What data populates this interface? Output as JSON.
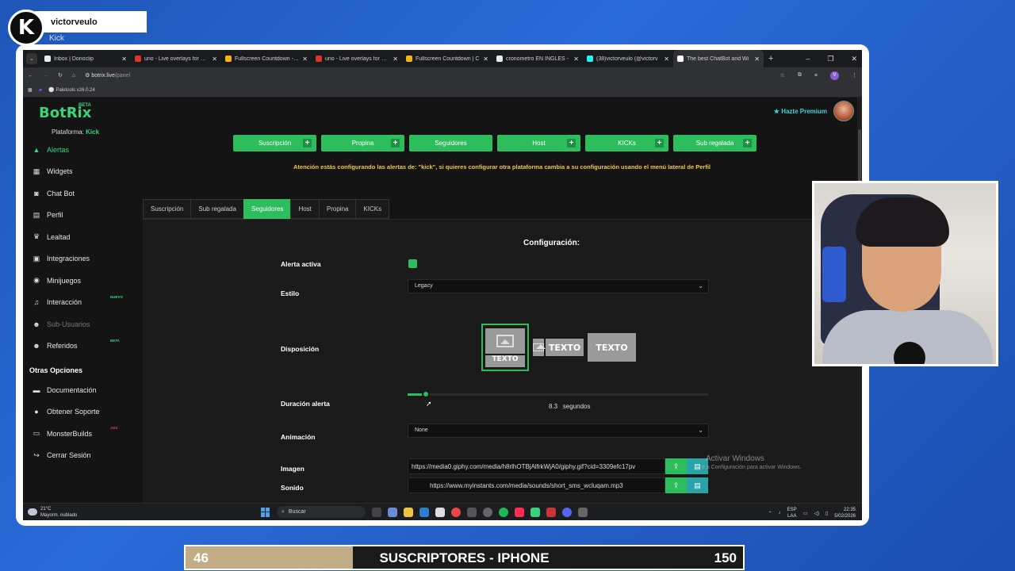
{
  "stream": {
    "channel_name": "victorveulo",
    "platform_label": "Kick"
  },
  "browser": {
    "tabs": [
      {
        "title": "Inbox | Donoclip",
        "color": "#e8eaed"
      },
      {
        "title": "uno - Live overlays for stre",
        "color": "#d8372a"
      },
      {
        "title": "Fullscreen Countdown - O",
        "color": "#f7b21a"
      },
      {
        "title": "uno - Live overlays for stre",
        "color": "#d8372a"
      },
      {
        "title": "Fullscreen Countdown | C",
        "color": "#f7b21a"
      },
      {
        "title": "cronometro EN INGLES -",
        "color": "#e8eaed"
      },
      {
        "title": "(38)victorveulo (@victorv",
        "color": "#25f4ee"
      },
      {
        "title": "The best ChatBot and Wi",
        "color": "#ffffff"
      }
    ],
    "url_host": "botrix.live",
    "url_path": "/panel",
    "bookmark": "Paletools v26.0.24"
  },
  "app": {
    "logo": "BotRix",
    "logo_badge": "BETA",
    "platform_label": "Plataforma:",
    "platform_value": "Kick",
    "premium": "Hazte Premium",
    "nav": [
      {
        "label": "Alertas",
        "icon": "bell-icon",
        "glyph": "▲"
      },
      {
        "label": "Widgets",
        "icon": "grid-icon",
        "glyph": "▦"
      },
      {
        "label": "Chat Bot",
        "icon": "robot-icon",
        "glyph": "◙"
      },
      {
        "label": "Perfil",
        "icon": "id-card-icon",
        "glyph": "▤"
      },
      {
        "label": "Lealtad",
        "icon": "trophy-icon",
        "glyph": "♛"
      },
      {
        "label": "Integraciones",
        "icon": "plug-icon",
        "glyph": "▣"
      },
      {
        "label": "Minijuegos",
        "icon": "gamepad-icon",
        "glyph": "◉"
      },
      {
        "label": "Interacción",
        "icon": "music-icon",
        "glyph": "♫",
        "tag": "NUEVO"
      },
      {
        "label": "Sub-Usuarios",
        "icon": "users-icon",
        "glyph": "☻"
      },
      {
        "label": "Referidos",
        "icon": "referrals-icon",
        "glyph": "☻",
        "tag": "BETA"
      }
    ],
    "other_title": "Otras Opciones",
    "other": [
      {
        "label": "Documentación",
        "icon": "book-icon",
        "glyph": "▬"
      },
      {
        "label": "Obtener Soporte",
        "icon": "support-icon",
        "glyph": "●"
      },
      {
        "label": "MonsterBuilds",
        "icon": "monitor-icon",
        "glyph": "▭",
        "tag": "ADS"
      },
      {
        "label": "Cerrar Sesión",
        "icon": "logout-icon",
        "glyph": "↪"
      }
    ],
    "alert_types": [
      "Suscripción",
      "Propina",
      "Seguidores",
      "Host",
      "KICKs",
      "Sub regalada"
    ],
    "warning": "Atención estás configurando las alertas de: \"kick\", si quieres configurar otra plataforma cambia a su configuración usando el menú lateral de Perfil",
    "subtabs": [
      "Suscripción",
      "Sub regalada",
      "Seguidores",
      "Host",
      "Propina",
      "KICKs"
    ],
    "config": {
      "title": "Configuración:",
      "active_label": "Alerta activa",
      "style_label": "Estilo",
      "style_value": "Legacy",
      "layout_label": "Disposición",
      "layout_text": "TEXTO",
      "duration_label": "Duración alerta",
      "duration_value": "8.3",
      "duration_unit": "segundos",
      "duration_fraction": 0.06,
      "animation_label": "Animación",
      "animation_value": "None",
      "image_label": "Imagen",
      "image_value": "https://media0.giphy.com/media/h8rlhOTBjAlfrkWjA0/giphy.gif?cid=3309efc17pv",
      "sound_label": "Sonido",
      "sound_value": "https://www.myinstants.com/media/sounds/short_sms_wcluqam.mp3"
    },
    "activate_windows": "Activar Windows",
    "activate_windows_sub": "e a Configuración para activar Windows."
  },
  "taskbar": {
    "temp": "21°C",
    "weather": "Mayorm. nublado",
    "search": "Buscar",
    "lang_top": "ESP",
    "lang_bottom": "LAA",
    "time": "22:35",
    "date": "5/02/2026"
  },
  "counter": {
    "current": "46",
    "label": "SUSCRIPTORES - IPHONE",
    "goal": "150",
    "progress_fraction": 0.3
  }
}
